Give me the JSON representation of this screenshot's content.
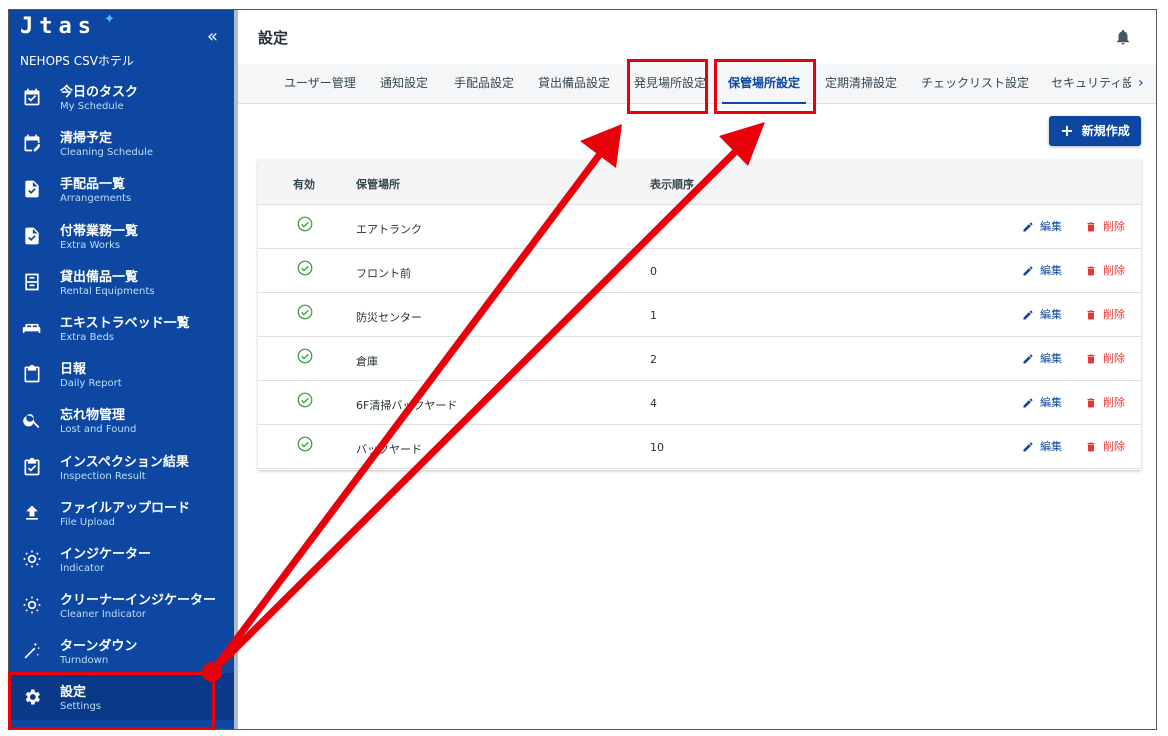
{
  "app": {
    "logo": "Jtas",
    "hotel_name": "NEHOPS CSVホテル",
    "collapse_glyph": "«"
  },
  "sidebar": {
    "items": [
      {
        "label": "今日のタスク",
        "sub": "My Schedule",
        "icon": "calendar-check-icon"
      },
      {
        "label": "清掃予定",
        "sub": "Cleaning Schedule",
        "icon": "calendar-edit-icon"
      },
      {
        "label": "手配品一覧",
        "sub": "Arrangements",
        "icon": "file-check-icon"
      },
      {
        "label": "付帯業務一覧",
        "sub": "Extra Works",
        "icon": "file-check-icon"
      },
      {
        "label": "貸出備品一覧",
        "sub": "Rental Equipments",
        "icon": "cabinet-icon"
      },
      {
        "label": "エキストラベッド一覧",
        "sub": "Extra Beds",
        "icon": "bed-icon"
      },
      {
        "label": "日報",
        "sub": "Daily Report",
        "icon": "clipboard-icon"
      },
      {
        "label": "忘れ物管理",
        "sub": "Lost and Found",
        "icon": "search-icon"
      },
      {
        "label": "インスペクション結果",
        "sub": "Inspection Result",
        "icon": "clipboard-check-icon"
      },
      {
        "label": "ファイルアップロード",
        "sub": "File Upload",
        "icon": "upload-icon"
      },
      {
        "label": "インジケーター",
        "sub": "Indicator",
        "icon": "sun-icon"
      },
      {
        "label": "クリーナーインジケーター",
        "sub": "Cleaner Indicator",
        "icon": "sun-icon"
      },
      {
        "label": "ターンダウン",
        "sub": "Turndown",
        "icon": "magic-wand-icon"
      },
      {
        "label": "設定",
        "sub": "Settings",
        "icon": "gear-icon"
      }
    ]
  },
  "header": {
    "title": "設定"
  },
  "tabs": [
    {
      "label": "ユーザー管理"
    },
    {
      "label": "通知設定"
    },
    {
      "label": "手配品設定"
    },
    {
      "label": "貸出備品設定"
    },
    {
      "label": "発見場所設定"
    },
    {
      "label": "保管場所設定"
    },
    {
      "label": "定期清掃設定"
    },
    {
      "label": "チェックリスト設定"
    },
    {
      "label": "セキュリティ設"
    }
  ],
  "tab_next_glyph": "›",
  "new_button": {
    "plus": "+",
    "label": "新規作成"
  },
  "table": {
    "columns": {
      "enabled": "有効",
      "location": "保管場所",
      "order": "表示順序"
    },
    "rows": [
      {
        "location": "エアトランク",
        "order": ""
      },
      {
        "location": "フロント前",
        "order": "0"
      },
      {
        "location": "防災センター",
        "order": "1"
      },
      {
        "location": "倉庫",
        "order": "2"
      },
      {
        "location": "6F清掃バックヤード",
        "order": "4"
      },
      {
        "location": "バックヤード",
        "order": "10"
      }
    ],
    "edit_label": "編集",
    "delete_label": "削除"
  },
  "colors": {
    "sidebar": "#0d47a1",
    "primary": "#0d47a1",
    "danger": "#e53935",
    "success": "#43a047",
    "annotation": "#e8000b"
  }
}
